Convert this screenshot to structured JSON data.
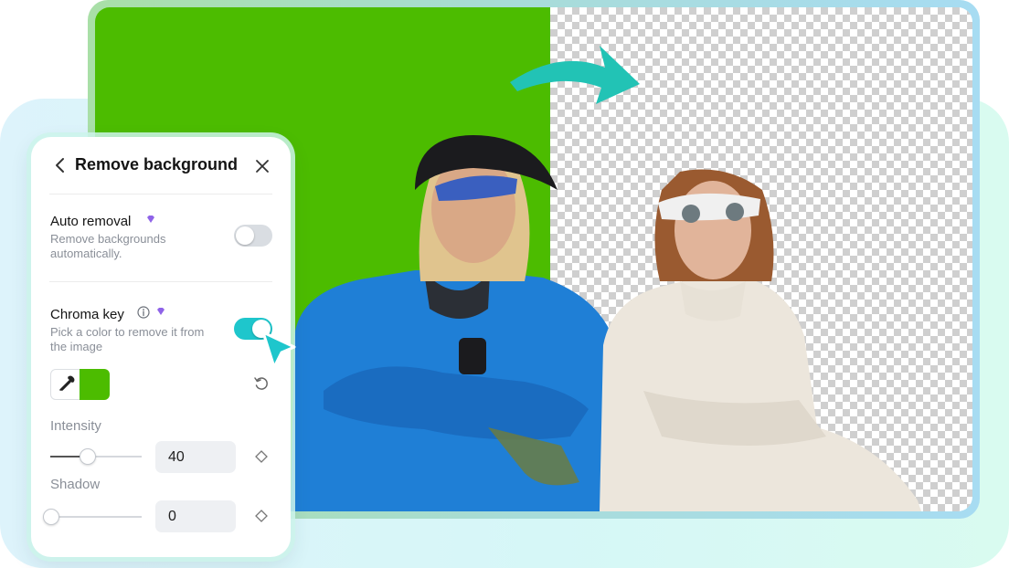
{
  "panel": {
    "title": "Remove background",
    "back_icon": "chevron-left-icon",
    "close_icon": "close-icon"
  },
  "auto_removal": {
    "title": "Auto removal",
    "description": "Remove backgrounds automatically.",
    "enabled": false,
    "premium_icon": "diamond-gem-icon"
  },
  "chroma_key": {
    "title": "Chroma key",
    "description": "Pick a color to remove it from the image",
    "enabled": true,
    "info_icon": "info-icon",
    "premium_icon": "diamond-gem-icon",
    "picked_color": "#4cbc00"
  },
  "intensity": {
    "label": "Intensity",
    "value": "40"
  },
  "shadow": {
    "label": "Shadow",
    "value": "0"
  },
  "colors": {
    "accent": "#1ec6cc",
    "green_screen": "#4cbc00",
    "jacket_blue": "#1f7fd6",
    "jacket_white": "#ece6dc"
  }
}
